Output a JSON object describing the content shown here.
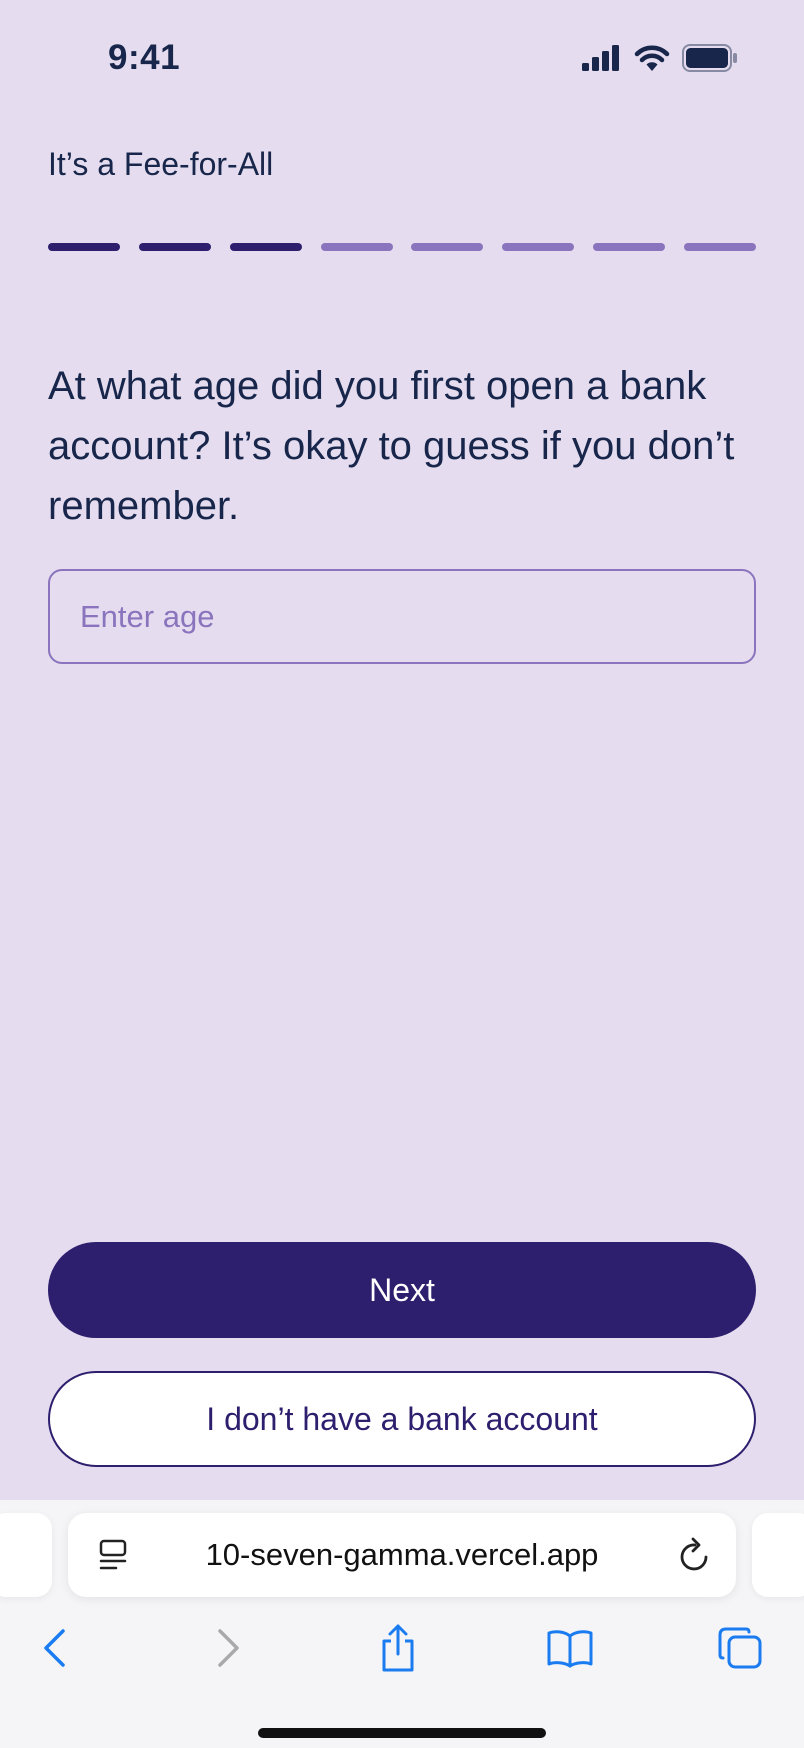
{
  "status_bar": {
    "time": "9:41"
  },
  "header": {
    "title": "It’s a Fee-for-All"
  },
  "progress": {
    "total_steps": 8,
    "completed_steps": 3
  },
  "question": {
    "text": "At what age did you first open a bank account? It’s okay to guess if you don’t remember."
  },
  "age_input": {
    "placeholder": "Enter age",
    "value": ""
  },
  "buttons": {
    "next_label": "Next",
    "no_bank_label": "I don’t have a bank account"
  },
  "browser": {
    "url": "10-seven-gamma.vercel.app"
  },
  "colors": {
    "background": "#e5ddef",
    "primary": "#2e1f6e",
    "progress_inactive": "#8a74bd",
    "text": "#17264a",
    "browser_accent": "#1a7cf0"
  },
  "icons": [
    "signal-icon",
    "wifi-icon",
    "battery-icon",
    "page-menu-icon",
    "reload-icon",
    "back-icon",
    "forward-icon",
    "share-icon",
    "bookmarks-icon",
    "tabs-icon"
  ]
}
